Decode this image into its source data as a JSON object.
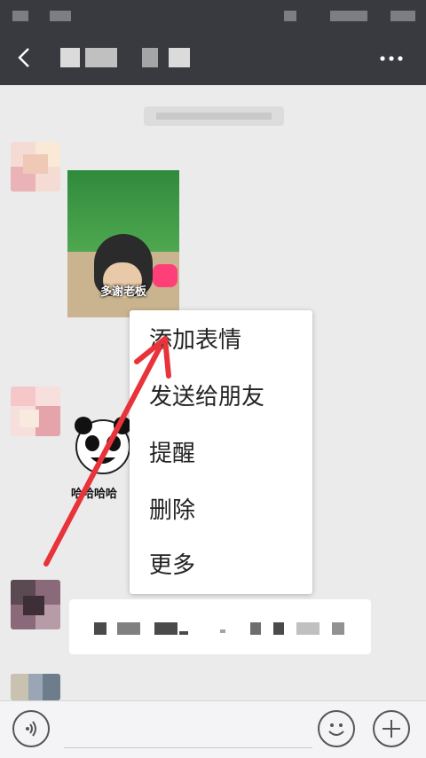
{
  "context_menu": {
    "items": [
      {
        "label": "添加表情"
      },
      {
        "label": "发送给朋友"
      },
      {
        "label": "提醒"
      },
      {
        "label": "删除"
      },
      {
        "label": "更多"
      }
    ]
  },
  "messages": {
    "sticker_1_caption": "多谢老板",
    "sticker_2_caption": "哈哈哈哈"
  },
  "colors": {
    "header_bg": "#393a3f",
    "chat_bg": "#ebebeb",
    "annotation_arrow": "#e8333a"
  },
  "icons": {
    "back": "chevron-left-icon",
    "more": "more-dots-icon",
    "voice": "voice-icon",
    "emoji": "emoji-icon",
    "plus": "plus-icon"
  }
}
